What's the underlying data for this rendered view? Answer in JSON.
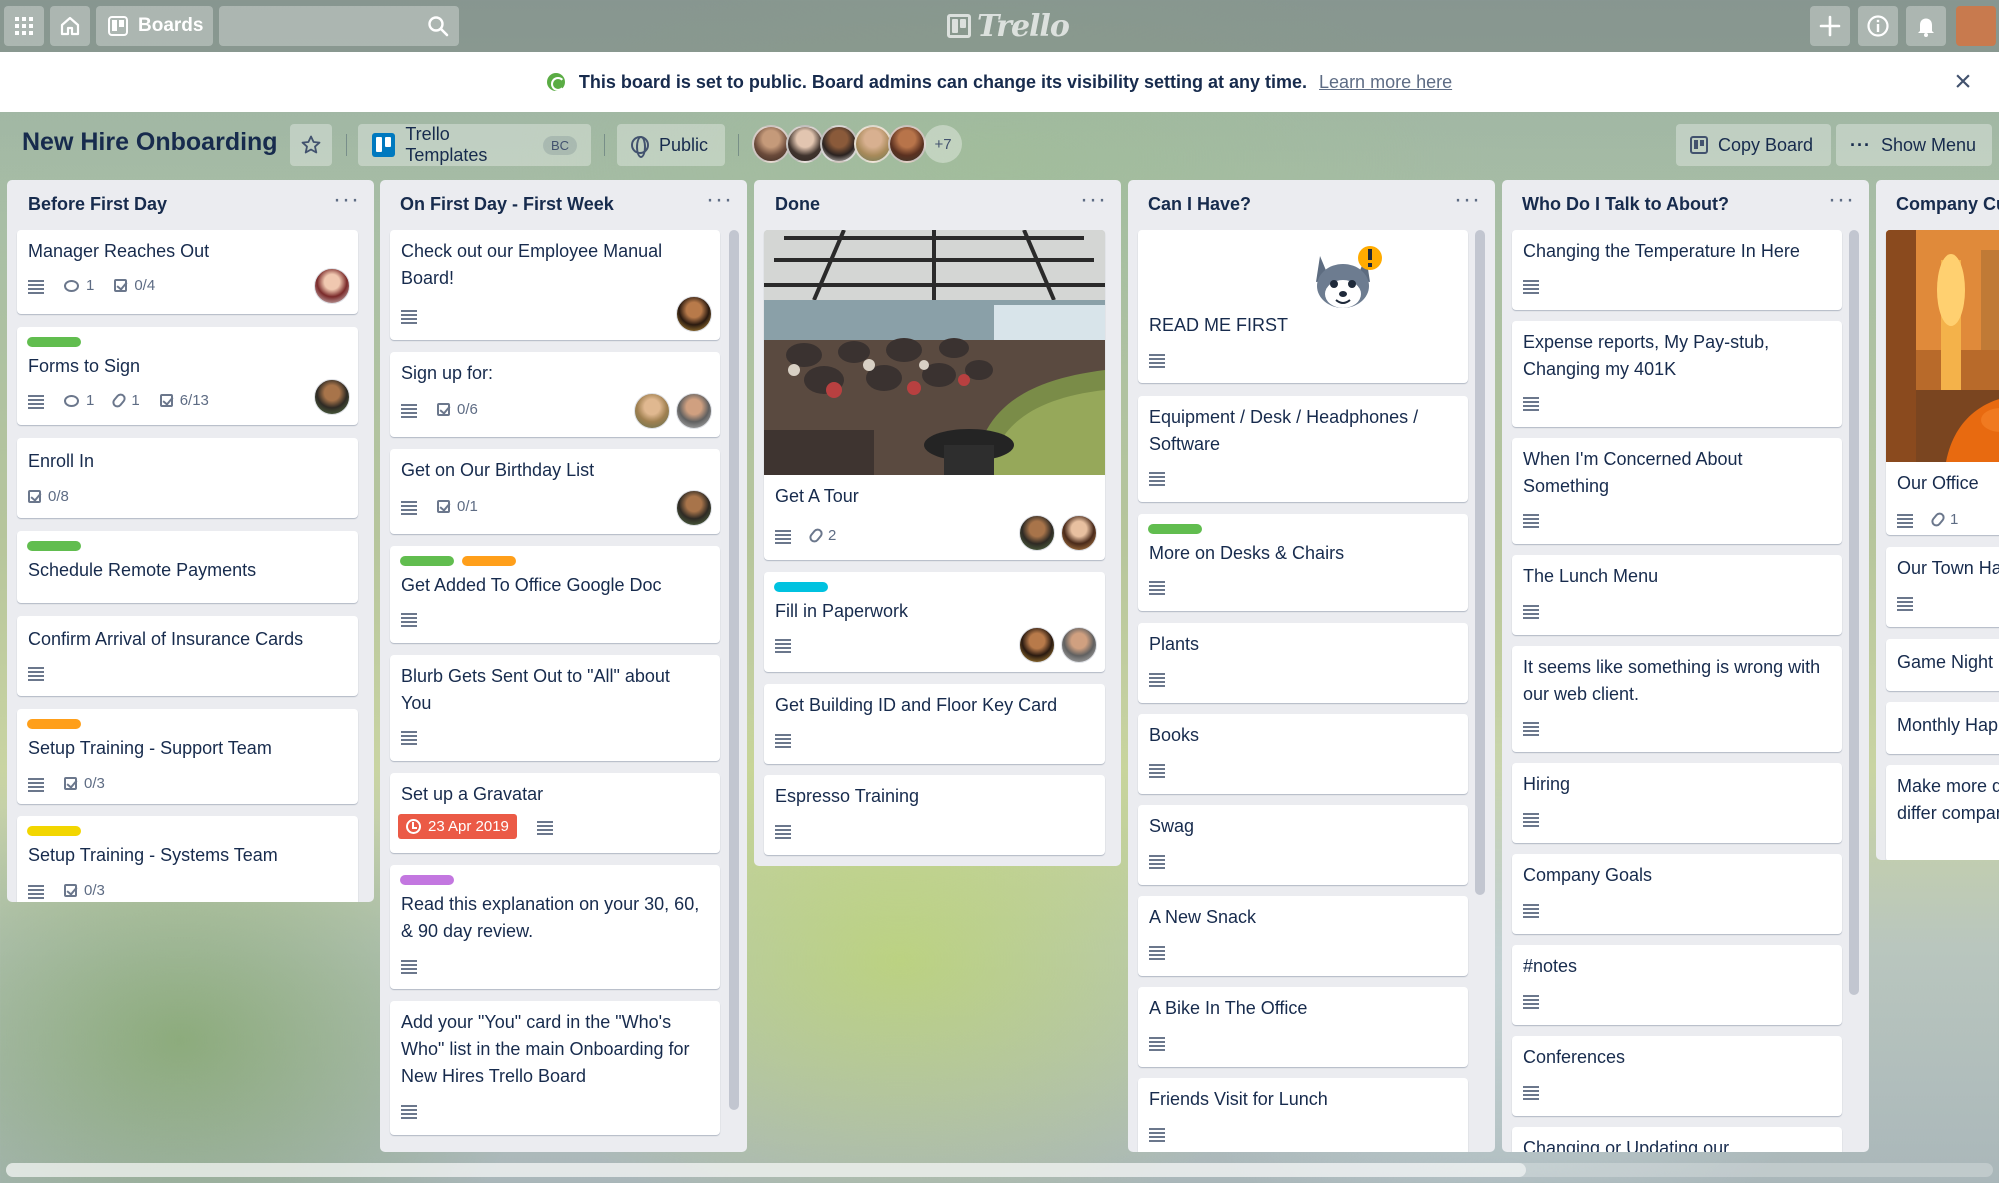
{
  "topnav": {
    "boards_label": "Boards",
    "search_placeholder": "",
    "logo_text": "Trello"
  },
  "banner": {
    "text": "This board is set to public. Board admins can change its visibility setting at any time.",
    "link": "Learn more here",
    "close": "×"
  },
  "board": {
    "title": "New Hire Onboarding",
    "team_name": "Trello Templates",
    "team_badge": "BC",
    "visibility": "Public",
    "more_members": "+7",
    "copy_board": "Copy Board",
    "show_menu": "Show Menu"
  },
  "colors": {
    "green": "#61bd4f",
    "orange": "#ff9f1a",
    "yellow": "#f2d600",
    "purple": "#c377e0",
    "sky": "#00c2e0",
    "due_red": "#eb5a46"
  },
  "lists": [
    {
      "title": "Before First Day",
      "menu": "···",
      "cards": [
        {
          "title": "Manager Reaches Out",
          "badges": {
            "desc": true,
            "comments": "1",
            "checklist": "0/4"
          },
          "avatars": 1
        },
        {
          "title": "Forms to Sign",
          "labels": [
            "green"
          ],
          "badges": {
            "desc": true,
            "comments": "1",
            "attachments": "1",
            "checklist": "6/13"
          },
          "avatars": 1
        },
        {
          "title": "Enroll In",
          "badges": {
            "checklist": "0/8"
          }
        },
        {
          "title": "Schedule Remote Payments",
          "labels": [
            "green"
          ]
        },
        {
          "title": "Confirm Arrival of Insurance Cards",
          "badges": {
            "desc": true
          }
        },
        {
          "title": "Setup Training - Support Team",
          "labels": [
            "orange"
          ],
          "badges": {
            "desc": true,
            "checklist": "0/3"
          }
        },
        {
          "title": "Setup Training - Systems Team",
          "labels": [
            "yellow"
          ],
          "badges": {
            "desc": true,
            "checklist": "0/3"
          }
        }
      ]
    },
    {
      "title": "On First Day - First Week",
      "menu": "···",
      "cards": [
        {
          "title": "Check out our Employee Manual Board!",
          "badges": {
            "desc": true
          },
          "avatars": 1
        },
        {
          "title": "Sign up for:",
          "badges": {
            "desc": true,
            "checklist": "0/6"
          },
          "avatars": 2
        },
        {
          "title": "Get on Our Birthday List",
          "badges": {
            "desc": true,
            "checklist": "0/1"
          },
          "avatars": 1
        },
        {
          "title": "Get Added To Office Google Doc",
          "labels": [
            "green",
            "orange"
          ],
          "badges": {
            "desc": true
          }
        },
        {
          "title": "Blurb Gets Sent Out to \"All\" about You",
          "badges": {
            "desc": true
          }
        },
        {
          "title": "Set up a Gravatar",
          "badges": {
            "due": "23 Apr 2019",
            "desc": true
          }
        },
        {
          "title": "Read this explanation on your 30, 60, & 90 day review.",
          "labels": [
            "purple"
          ],
          "badges": {
            "desc": true
          }
        },
        {
          "title": "Add your \"You\" card in the \"Who's Who\" list in the main Onboarding for New Hires Trello Board",
          "badges": {
            "desc": true
          }
        }
      ]
    },
    {
      "title": "Done",
      "menu": "···",
      "cards": [
        {
          "title": "Get A Tour",
          "cover": "office-photo",
          "badges": {
            "desc": true,
            "attachments": "2"
          },
          "avatars": 2
        },
        {
          "title": "Fill in Paperwork",
          "labels": [
            "sky"
          ],
          "badges": {
            "desc": true
          },
          "avatars": 2
        },
        {
          "title": "Get Building ID and Floor Key Card",
          "badges": {
            "desc": true
          }
        },
        {
          "title": "Espresso Training",
          "badges": {
            "desc": true
          }
        }
      ]
    },
    {
      "title": "Can I Have?",
      "menu": "···",
      "cards": [
        {
          "title": "READ ME FIRST",
          "sticker": "husky-sticker",
          "badges": {
            "desc": true
          }
        },
        {
          "title": "Equipment / Desk / Headphones / Software",
          "badges": {
            "desc": true
          }
        },
        {
          "title": "More on Desks & Chairs",
          "labels": [
            "green"
          ],
          "badges": {
            "desc": true
          }
        },
        {
          "title": "Plants",
          "badges": {
            "desc": true
          }
        },
        {
          "title": "Books",
          "badges": {
            "desc": true
          }
        },
        {
          "title": "Swag",
          "badges": {
            "desc": true
          }
        },
        {
          "title": "A New Snack",
          "badges": {
            "desc": true
          }
        },
        {
          "title": "A Bike In The Office",
          "badges": {
            "desc": true
          }
        },
        {
          "title": "Friends Visit for Lunch",
          "badges": {
            "desc": true
          }
        }
      ]
    },
    {
      "title": "Who Do I Talk to About?",
      "menu": "···",
      "cards": [
        {
          "title": "Changing the Temperature In Here",
          "badges": {
            "desc": true
          }
        },
        {
          "title": "Expense reports, My Pay-stub, Changing my 401K",
          "badges": {
            "desc": true
          }
        },
        {
          "title": "When I'm Concerned About Something",
          "badges": {
            "desc": true
          }
        },
        {
          "title": "The Lunch Menu",
          "badges": {
            "desc": true
          }
        },
        {
          "title": "It seems like something is wrong with our web client.",
          "badges": {
            "desc": true
          }
        },
        {
          "title": "Hiring",
          "badges": {
            "desc": true
          }
        },
        {
          "title": "Company Goals",
          "badges": {
            "desc": true
          }
        },
        {
          "title": "#notes",
          "badges": {
            "desc": true
          }
        },
        {
          "title": "Conferences",
          "badges": {
            "desc": true
          }
        },
        {
          "title": "Changing or Updating our"
        }
      ]
    },
    {
      "title": "Company Cu",
      "menu": "",
      "cards": [
        {
          "title": "Our Office",
          "cover": "lounge-photo",
          "badges": {
            "desc": true,
            "attachments": "1"
          }
        },
        {
          "title": "Our Town Ha",
          "badges": {
            "desc": true
          }
        },
        {
          "title": "Game Night"
        },
        {
          "title": "Monthly Hap"
        },
        {
          "title": "Make more discuss differ company's c"
        }
      ]
    }
  ]
}
